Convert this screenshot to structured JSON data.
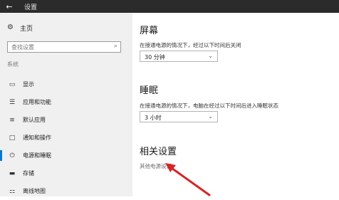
{
  "window": {
    "title": "设置",
    "back_icon": "arrow-left-icon"
  },
  "sidebar": {
    "home_label": "主页",
    "search_placeholder": "查找设置",
    "section_label": "系统",
    "items": [
      {
        "label": "显示",
        "icon": "monitor-icon"
      },
      {
        "label": "应用和功能",
        "icon": "apps-list-icon"
      },
      {
        "label": "默认应用",
        "icon": "default-apps-icon"
      },
      {
        "label": "通知和操作",
        "icon": "notification-icon"
      },
      {
        "label": "电源和睡眠",
        "icon": "power-icon",
        "active": true
      },
      {
        "label": "存储",
        "icon": "storage-icon"
      },
      {
        "label": "离线地图",
        "icon": "map-icon"
      }
    ]
  },
  "main": {
    "screen": {
      "heading": "屏幕",
      "description": "在接通电源的情况下，经过以下时间后关闭",
      "value": "30 分钟"
    },
    "sleep": {
      "heading": "睡眠",
      "description": "在接通电源的情况下，电脑在经过以下时间后进入睡眠状态",
      "value": "3 小时"
    },
    "related": {
      "heading": "相关设置",
      "link": "其他电源设置"
    }
  },
  "colors": {
    "titlebar": "#2b2b2b",
    "sidebar_bg": "#f0f0f0",
    "accent": "#0078d7",
    "annotation_arrow": "#d62424"
  }
}
